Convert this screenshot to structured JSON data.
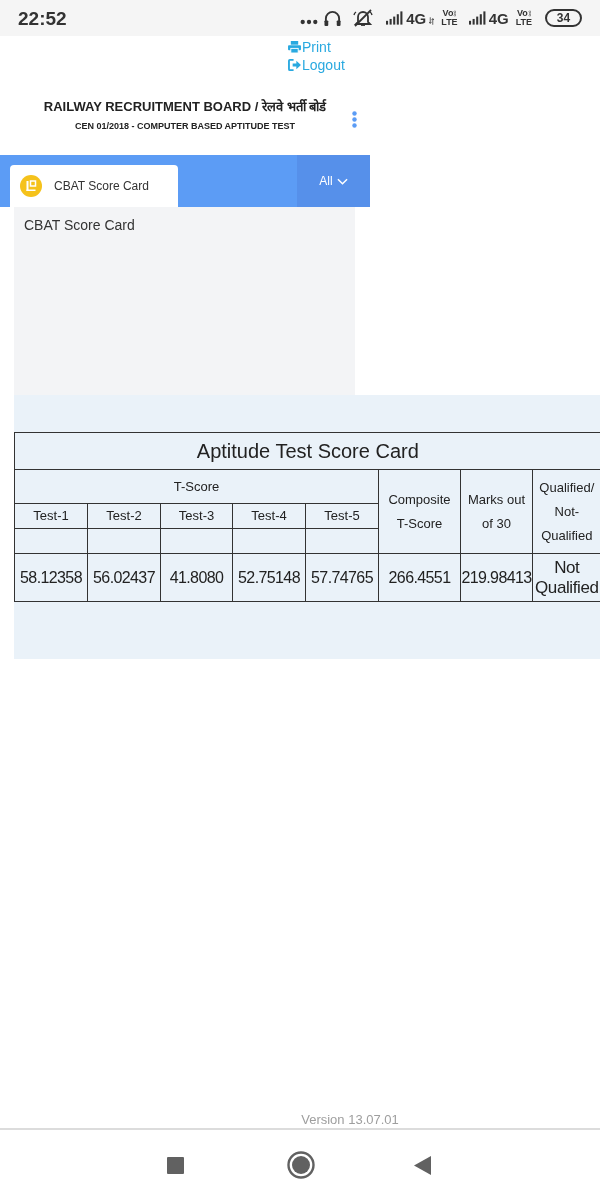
{
  "status_bar": {
    "time": "22:52",
    "sims": [
      {
        "network": "4G",
        "data_active": true,
        "volte": "Vo",
        "volte_sub": "LTE"
      },
      {
        "network": "4G",
        "data_active": false,
        "volte": "Vo",
        "volte_sub": "LTE"
      }
    ],
    "battery": "34"
  },
  "top_links": [
    {
      "kind": "print",
      "label": "Print"
    },
    {
      "kind": "logout",
      "label": "Logout"
    }
  ],
  "header": {
    "title": "RAILWAY RECRUITMENT BOARD / रेलवे भर्ती बोर्ड",
    "subtitle": "CEN 01/2018 - COMPUTER BASED APTITUDE TEST"
  },
  "tabs": [
    {
      "label": "CBAT Score Card",
      "selected": true
    }
  ],
  "filter": {
    "label": "All"
  },
  "panel": {
    "title": "CBAT Score Card"
  },
  "score_table": {
    "title": "Aptitude Test Score Card",
    "header_rows": [
      [
        {
          "text": "T-Score",
          "colspan": 5
        },
        {
          "text": "Composite T-Score",
          "rowspan": 3
        },
        {
          "text": "Marks out of 30",
          "rowspan": 3
        },
        {
          "text": "Qualified/ Not-Qualified",
          "rowspan": 3
        }
      ],
      [
        {
          "text": "Test-1"
        },
        {
          "text": "Test-2"
        },
        {
          "text": "Test-3"
        },
        {
          "text": "Test-4"
        },
        {
          "text": "Test-5"
        }
      ],
      [
        {
          "text": ""
        },
        {
          "text": ""
        },
        {
          "text": ""
        },
        {
          "text": ""
        },
        {
          "text": ""
        }
      ]
    ],
    "rows": [
      [
        "58.12358",
        "56.02437",
        "41.8080",
        "52.75148",
        "57.74765",
        "266.4551",
        "219.98413",
        "Not Qualified"
      ]
    ]
  },
  "footer": {
    "version": "Version 13.07.01"
  }
}
